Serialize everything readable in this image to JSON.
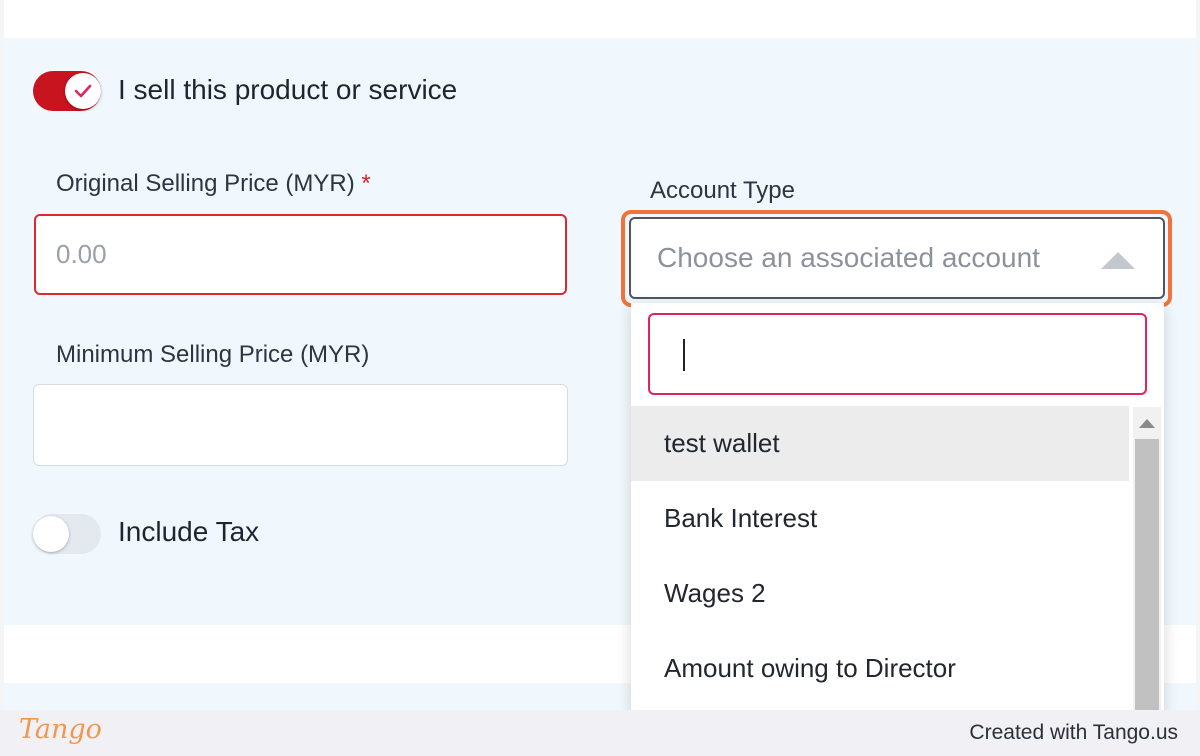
{
  "form": {
    "sell_toggle": {
      "label": "I sell this product or service",
      "checked": true
    },
    "original_price": {
      "label": "Original Selling Price (MYR)",
      "required_mark": "*",
      "placeholder": "0.00",
      "value": ""
    },
    "minimum_price": {
      "label": "Minimum Selling Price (MYR)",
      "value": ""
    },
    "tax_toggle": {
      "label": "Include Tax",
      "checked": false
    },
    "account_type": {
      "label": "Account Type",
      "placeholder": "Choose an associated account",
      "search_value": "",
      "options": [
        "test wallet",
        "Bank Interest",
        "Wages 2",
        "Amount owing to Director"
      ],
      "hovered_index": 0
    }
  },
  "footer": {
    "logo": "Tango",
    "credit": "Created with Tango.us"
  },
  "colors": {
    "toggle_on": "#c8141f",
    "error_border": "#e0262e",
    "highlight": "#f1733b",
    "panel_bg": "#f0f8fd"
  }
}
